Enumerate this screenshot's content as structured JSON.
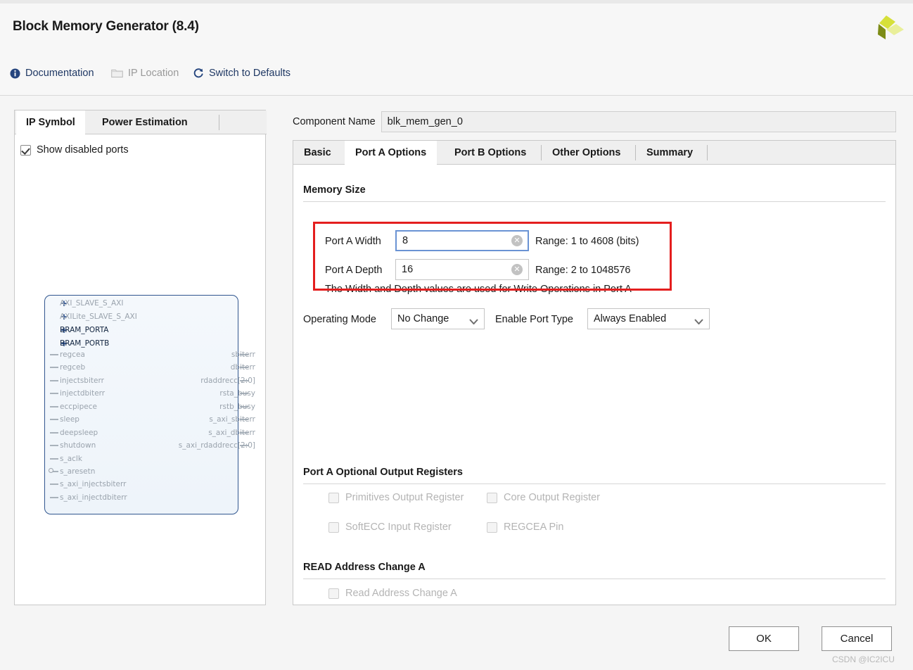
{
  "window": {
    "title": "Block Memory Generator (8.4)",
    "logo_icon": "xilinx-logo"
  },
  "toolbar": {
    "documentation": {
      "label": "Documentation",
      "icon": "info-icon"
    },
    "ip_location": {
      "label": "IP Location",
      "icon": "folder-icon",
      "enabled": false
    },
    "switch_defaults": {
      "label": "Switch to Defaults",
      "icon": "refresh-icon"
    }
  },
  "left_panel": {
    "tabs": [
      {
        "label": "IP Symbol",
        "active": true
      },
      {
        "label": "Power Estimation",
        "active": false
      }
    ],
    "show_disabled_ports": {
      "label": "Show disabled ports",
      "checked": true
    },
    "symbol": {
      "bus_ports": [
        {
          "name": "AXI_SLAVE_S_AXI",
          "enabled": false
        },
        {
          "name": "AXILite_SLAVE_S_AXI",
          "enabled": false
        },
        {
          "name": "BRAM_PORTA",
          "enabled": true
        },
        {
          "name": "BRAM_PORTB",
          "enabled": true
        }
      ],
      "input_ports": [
        "regcea",
        "regceb",
        "injectsbiterr",
        "injectdbiterr",
        "eccpipece",
        "sleep",
        "deepsleep",
        "shutdown",
        "s_aclk",
        "s_aresetn",
        "s_axi_injectsbiterr",
        "s_axi_injectdbiterr"
      ],
      "output_ports": [
        "sbiterr",
        "dbiterr",
        "rdaddrecc[2:0]",
        "rsta_busy",
        "rstb_busy",
        "s_axi_sbiterr",
        "s_axi_dbiterr",
        "s_axi_rdaddrecc[2:0]"
      ]
    }
  },
  "component": {
    "label": "Component Name",
    "value": "blk_mem_gen_0"
  },
  "right_panel": {
    "tabs": [
      {
        "label": "Basic",
        "active": false
      },
      {
        "label": "Port A Options",
        "active": true
      },
      {
        "label": "Port B Options",
        "active": false
      },
      {
        "label": "Other Options",
        "active": false
      },
      {
        "label": "Summary",
        "active": false
      }
    ],
    "memory_size": {
      "heading": "Memory Size",
      "width": {
        "label": "Port A Width",
        "value": "8",
        "range": "Range: 1 to 4608 (bits)",
        "focused": true
      },
      "depth": {
        "label": "Port A Depth",
        "value": "16",
        "range": "Range: 2 to 1048576",
        "focused": false
      },
      "note": "The Width and Depth values are used for Write Operations in Port A",
      "highlight_color": "#e41e1e"
    },
    "operating_mode": {
      "label": "Operating Mode",
      "value": "No Change"
    },
    "enable_port_type": {
      "label": "Enable Port Type",
      "value": "Always Enabled"
    },
    "optional_output_registers": {
      "heading": "Port A Optional Output Registers",
      "items": [
        {
          "label": "Primitives Output Register",
          "checked": false,
          "enabled": false
        },
        {
          "label": "Core Output Register",
          "checked": false,
          "enabled": false
        },
        {
          "label": "SoftECC Input Register",
          "checked": false,
          "enabled": false
        },
        {
          "label": "REGCEA Pin",
          "checked": false,
          "enabled": false
        }
      ]
    },
    "read_address_change": {
      "heading": "READ Address Change A",
      "items": [
        {
          "label": "Read Address Change A",
          "checked": false,
          "enabled": false
        }
      ]
    }
  },
  "footer": {
    "ok": "OK",
    "cancel": "Cancel",
    "watermark": "CSDN @IC2ICU"
  }
}
